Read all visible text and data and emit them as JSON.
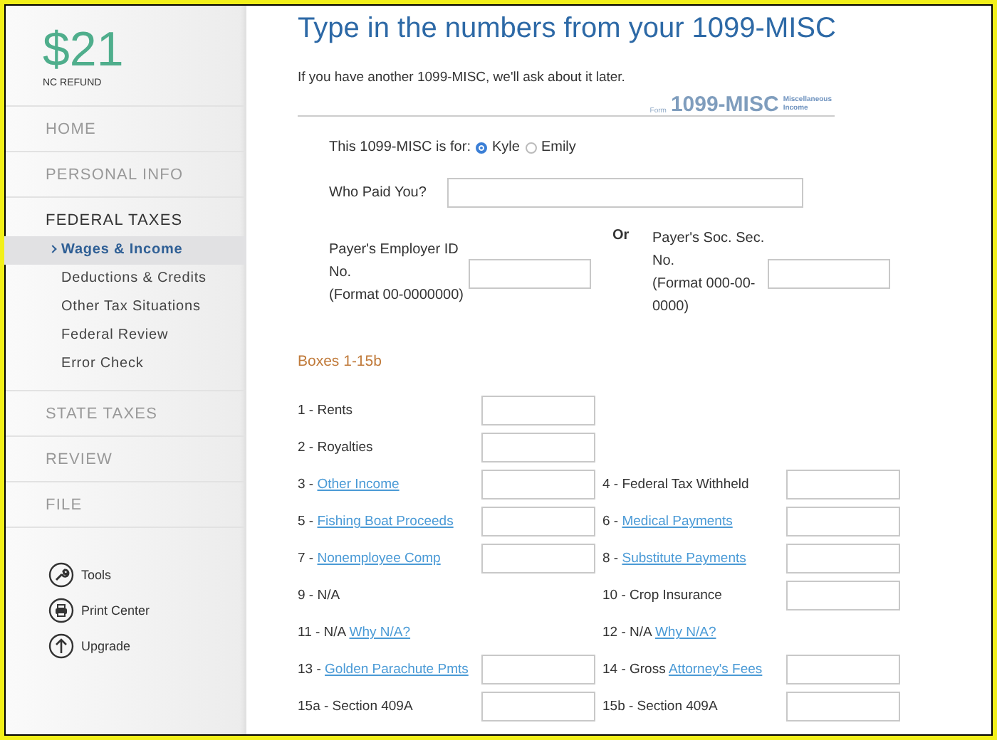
{
  "refund": {
    "amount": "$21",
    "label": "NC REFUND"
  },
  "sidebar": {
    "sections": [
      {
        "label": "HOME",
        "selected": false
      },
      {
        "label": "PERSONAL INFO",
        "selected": false
      },
      {
        "label": "FEDERAL TAXES",
        "selected": true,
        "children": [
          {
            "label": "Wages & Income",
            "selected": true
          },
          {
            "label": "Deductions & Credits",
            "selected": false
          },
          {
            "label": "Other Tax Situations",
            "selected": false
          },
          {
            "label": "Federal Review",
            "selected": false
          },
          {
            "label": "Error Check",
            "selected": false
          }
        ]
      },
      {
        "label": "STATE TAXES",
        "selected": false
      },
      {
        "label": "REVIEW",
        "selected": false
      },
      {
        "label": "FILE",
        "selected": false
      }
    ],
    "tools": [
      {
        "kind": "wrench",
        "label": "Tools"
      },
      {
        "kind": "printer",
        "label": "Print Center"
      },
      {
        "kind": "upgrade",
        "label": "Upgrade"
      }
    ]
  },
  "title": "Type in the numbers from your 1099-MISC",
  "subtitle": "If you have another 1099-MISC, we'll ask about it later.",
  "form_badge": {
    "prefix": "Form",
    "number": "1099-MISC",
    "name_1": "Miscellaneous",
    "name_2": "Income"
  },
  "recipient": {
    "label": "This 1099-MISC is for:",
    "options": [
      {
        "label": "Kyle",
        "selected": true
      },
      {
        "label": "Emily",
        "selected": false
      }
    ]
  },
  "payer": {
    "label": "Who Paid You?"
  },
  "ids": {
    "left": {
      "label": "Payer's Employer ID No.",
      "format": "(Format 00-0000000)"
    },
    "separator": "Or",
    "right": {
      "label": "Payer's Soc. Sec. No.",
      "format": "(Format 000-00-0000)"
    }
  },
  "boxes_heading": "Boxes 1-15b",
  "box_rows": [
    [
      {
        "prefix": "1 - Rents",
        "field": true
      }
    ],
    [
      {
        "prefix": "2 - Royalties",
        "field": true
      }
    ],
    [
      {
        "prefix": "3 - ",
        "link": "Other Income",
        "field": true
      },
      {
        "prefix": "4 - Federal Tax Withheld",
        "field": true
      }
    ],
    [
      {
        "prefix": "5 - ",
        "link": "Fishing Boat Proceeds",
        "field": true
      },
      {
        "prefix": "6 - ",
        "link": "Medical Payments",
        "field": true
      }
    ],
    [
      {
        "prefix": "7 - ",
        "link": "Nonemployee Comp",
        "field": true
      },
      {
        "prefix": "8 - ",
        "link": "Substitute Payments",
        "field": true
      }
    ],
    [
      {
        "prefix": "9 - N/A",
        "field": false
      },
      {
        "prefix": "10 - Crop Insurance",
        "field": true
      }
    ],
    [
      {
        "prefix": "11 - N/A ",
        "link": "Why N/A?",
        "field": false
      },
      {
        "prefix": "12 - N/A ",
        "link": "Why N/A?",
        "field": false
      }
    ],
    [
      {
        "prefix": "13 - ",
        "link": "Golden Parachute Pmts",
        "field": true
      },
      {
        "prefix": "14 - Gross ",
        "link": "Attorney's Fees",
        "field": true
      }
    ],
    [
      {
        "prefix": "15a - Section 409A",
        "field": true
      },
      {
        "prefix": "15b - Section 409A",
        "field": true
      }
    ]
  ]
}
